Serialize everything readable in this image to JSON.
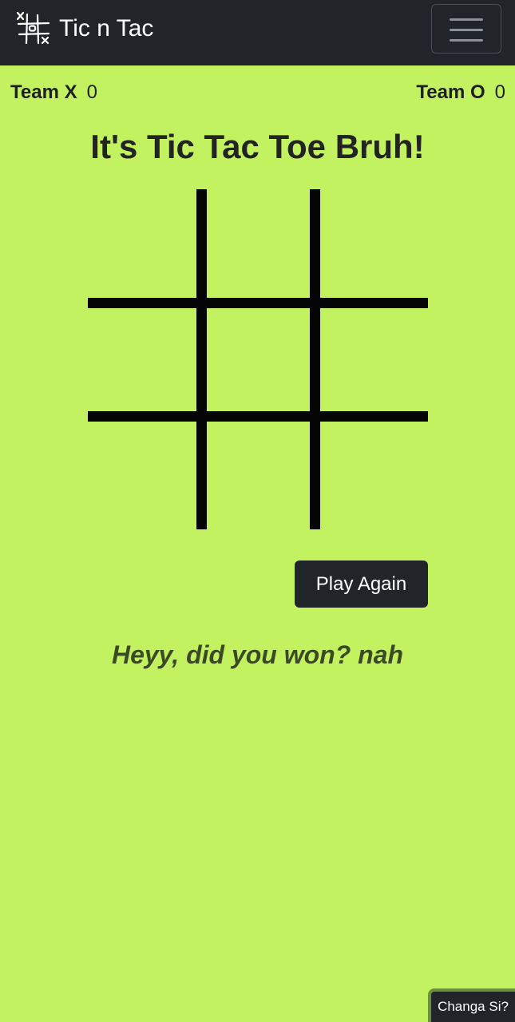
{
  "navbar": {
    "brand": "Tic n Tac",
    "logo_icon": "tic-tac-toe-logo-icon",
    "menu_icon": "hamburger-menu-icon"
  },
  "scoreboard": {
    "team_x": {
      "label": "Team X",
      "score": "0"
    },
    "team_o": {
      "label": "Team O",
      "score": "0"
    }
  },
  "main": {
    "title": "It's Tic Tac Toe Bruh!",
    "board": {
      "cells": [
        "",
        "",
        "",
        "",
        "",
        "",
        "",
        "",
        ""
      ]
    },
    "play_again_label": "Play Again",
    "message": "Heyy, did you won? nah"
  },
  "footer": {
    "language_button": "Changa Si?"
  },
  "colors": {
    "background": "#c2f260",
    "navbar": "#212529",
    "button": "#212529",
    "message": "#3b4a24"
  }
}
